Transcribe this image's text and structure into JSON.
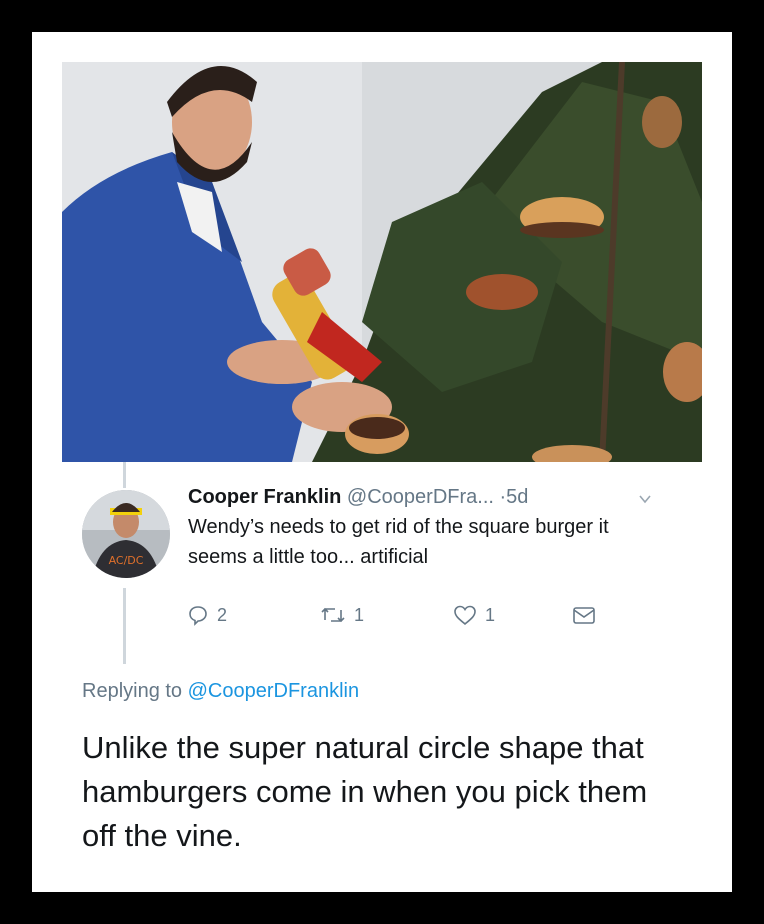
{
  "tweet": {
    "author_name": "Cooper Franklin",
    "author_handle": "@CooperDFra...",
    "separator": "·",
    "time": "5d",
    "text": "Wendy’s needs to get rid of the square burger it seems a little too... artificial",
    "replies": "2",
    "retweets": "1",
    "likes": "1",
    "icons": {
      "reply": "reply-icon",
      "retweet": "retweet-icon",
      "like": "heart-icon",
      "dm": "envelope-icon",
      "menu": "chevron-down-icon"
    }
  },
  "reply": {
    "replying_prefix": "Replying to",
    "replying_to": "@CooperDFranklin",
    "text": "Unlike the super natural circle shape that hamburgers come in when you pick them off the vine."
  },
  "colors": {
    "text": "#14171a",
    "secondary": "#657786",
    "link": "#1b95e0",
    "frame": "#000000"
  }
}
